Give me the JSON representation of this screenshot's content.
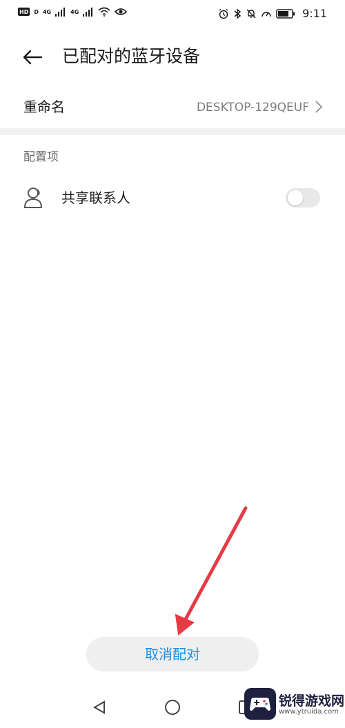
{
  "status_bar": {
    "left_badge": "HD",
    "left_badge_small": "D",
    "network_1": "4G",
    "network_2": "4G",
    "time": "9:11"
  },
  "header": {
    "title": "已配对的蓝牙设备"
  },
  "rename": {
    "label": "重命名",
    "value": "DESKTOP-129QEUF"
  },
  "config": {
    "section_label": "配置项",
    "share_contacts_label": "共享联系人",
    "share_contacts_enabled": false
  },
  "actions": {
    "unpair_label": "取消配对"
  },
  "watermark": {
    "name": "锐得游戏网",
    "url": "www.ytruida.com"
  },
  "colors": {
    "accent": "#1d8de3",
    "annotation": "#e53b45",
    "divider": "#f1f1f1"
  }
}
